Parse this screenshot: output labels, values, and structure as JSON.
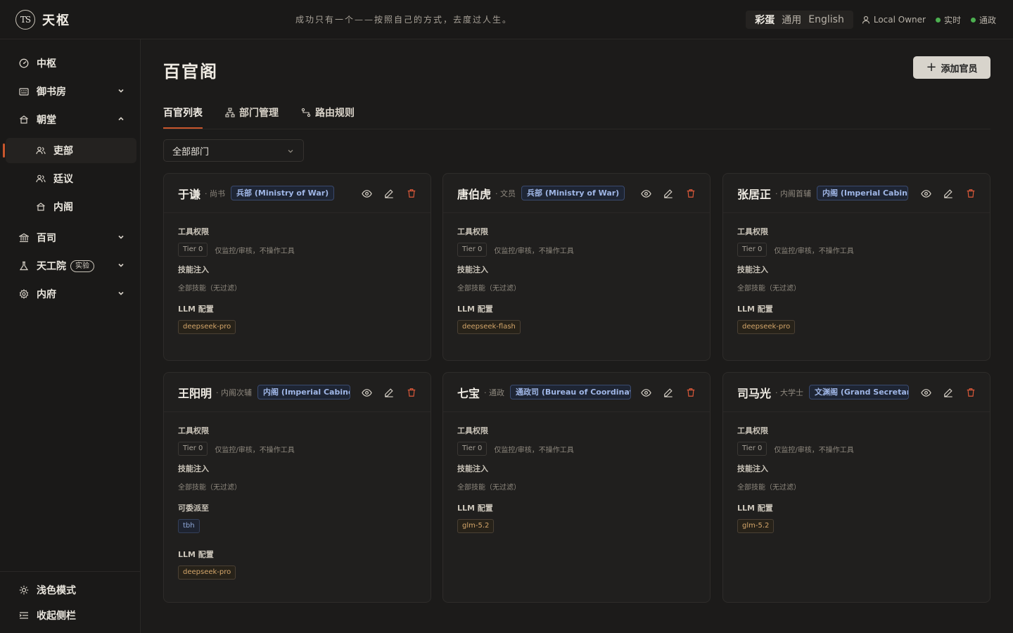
{
  "app": {
    "logo_text": "TS",
    "name": "天枢",
    "motto": "成功只有一个——按照自己的方式，去度过人生。"
  },
  "topbar": {
    "langs": [
      "彩蛋",
      "通用",
      "English"
    ],
    "owner": "Local Owner",
    "status_realtime": "实时",
    "status_gov": "通政"
  },
  "sidebar": {
    "items": [
      {
        "label": "中枢",
        "icon": "dashboard-icon"
      },
      {
        "label": "御书房",
        "icon": "study-icon"
      },
      {
        "label": "朝堂",
        "icon": "court-icon"
      },
      {
        "label": "吏部",
        "icon": "people-icon"
      },
      {
        "label": "廷议",
        "icon": "people-icon"
      },
      {
        "label": "内阁",
        "icon": "court-icon"
      },
      {
        "label": "百司",
        "icon": "bank-icon"
      },
      {
        "label": "天工院",
        "icon": "lab-icon",
        "badge": "实验"
      },
      {
        "label": "内府",
        "icon": "gear-icon"
      }
    ],
    "light_mode": "浅色模式",
    "collapse": "收起侧栏"
  },
  "main": {
    "title": "百官阁",
    "add_button": "添加官员",
    "tabs": [
      "百官列表",
      "部门管理",
      "路由规则"
    ],
    "filter": "全部部门"
  },
  "labels": {
    "tool_perm": "工具权限",
    "tier": "Tier 0",
    "tier_desc": "仅监控/审核，不操作工具",
    "skill": "技能注入",
    "skill_all": "全部技能（无过滤）",
    "llm": "LLM 配置",
    "dispatch": "可委派至"
  },
  "cards": [
    {
      "name": "于谦",
      "role": "· 尚书",
      "dept": "兵部 (Ministry of War)",
      "llm": "deepseek-pro"
    },
    {
      "name": "唐伯虎",
      "role": "· 文员",
      "dept": "兵部 (Ministry of War)",
      "llm": "deepseek-flash"
    },
    {
      "name": "张居正",
      "role": "· 内阁首辅",
      "dept": "内阁 (Imperial Cabinet)",
      "llm": "deepseek-pro"
    },
    {
      "name": "王阳明",
      "role": "· 内阁次辅",
      "dept": "内阁 (Imperial Cabinet)",
      "dispatch": "tbh",
      "llm": "deepseek-pro"
    },
    {
      "name": "七宝",
      "role": "· 通政",
      "dept": "通政司 (Bureau of Coordination)",
      "llm": "glm-5.2"
    },
    {
      "name": "司马光",
      "role": "· 大学士",
      "dept": "文渊阁 (Grand Secretariat)",
      "llm": "glm-5.2"
    }
  ]
}
